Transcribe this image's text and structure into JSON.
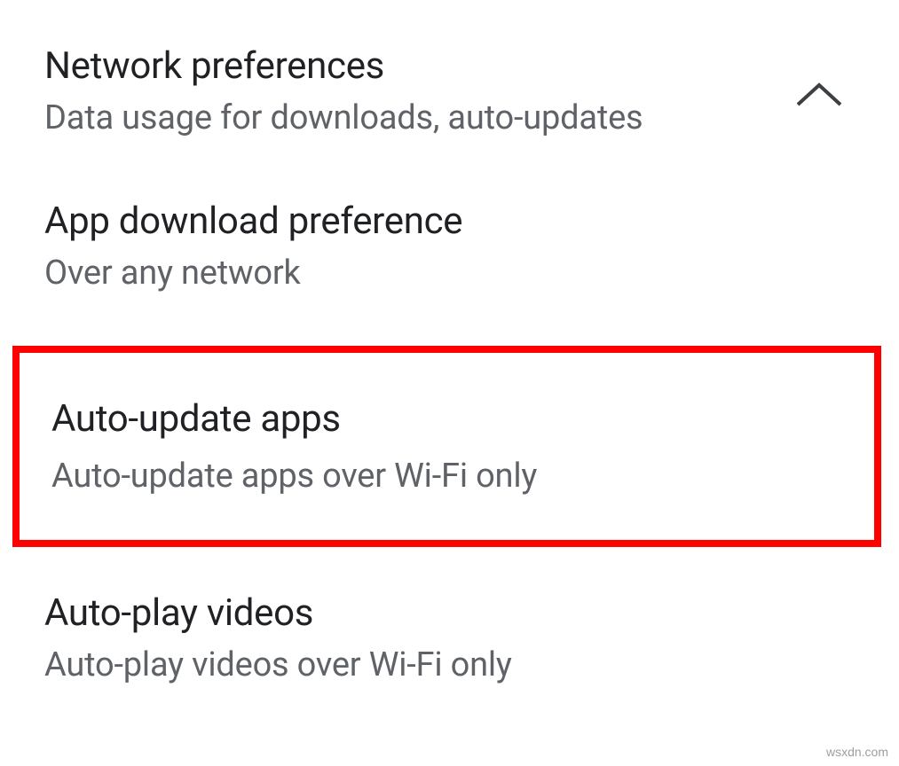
{
  "sections": {
    "network_preferences": {
      "title": "Network preferences",
      "subtitle": "Data usage for downloads, auto-updates",
      "expanded": true
    }
  },
  "settings": {
    "app_download_preference": {
      "title": "App download preference",
      "subtitle": "Over any network"
    },
    "auto_update_apps": {
      "title": "Auto-update apps",
      "subtitle": "Auto-update apps over Wi-Fi only",
      "highlighted": true
    },
    "auto_play_videos": {
      "title": "Auto-play videos",
      "subtitle": "Auto-play videos over Wi-Fi only"
    }
  },
  "watermark": "wsxdn.com"
}
